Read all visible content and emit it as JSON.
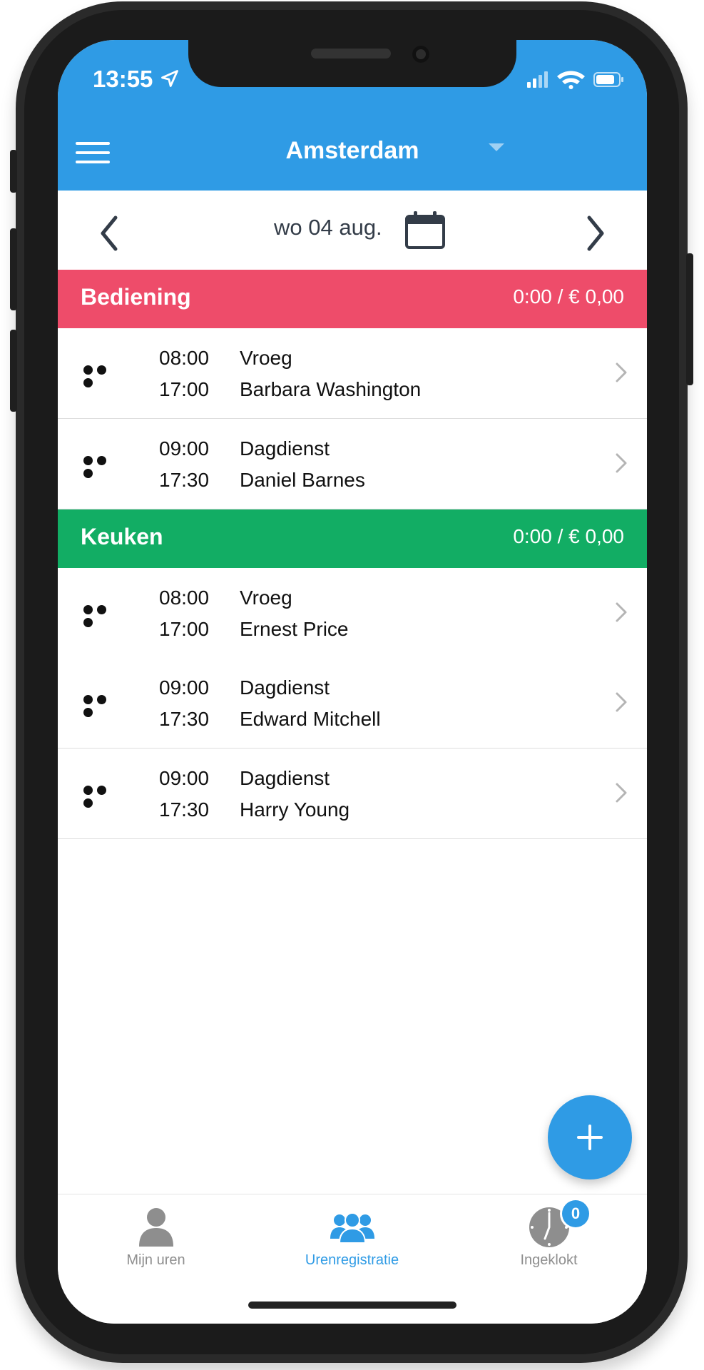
{
  "status": {
    "time": "13:55"
  },
  "header": {
    "title": "Amsterdam"
  },
  "date": {
    "label": "wo 04 aug."
  },
  "sections": [
    {
      "name": "Bediening",
      "total": "0:00 / € 0,00",
      "color": "#ee4c6a",
      "rows": [
        {
          "start": "08:00",
          "end": "17:00",
          "shift": "Vroeg",
          "person": "Barbara Washington"
        },
        {
          "start": "09:00",
          "end": "17:30",
          "shift": "Dagdienst",
          "person": "Daniel Barnes"
        }
      ]
    },
    {
      "name": "Keuken",
      "total": "0:00 / € 0,00",
      "color": "#12ad64",
      "rows": [
        {
          "start": "08:00",
          "end": "17:00",
          "shift": "Vroeg",
          "person": "Ernest Price"
        },
        {
          "start": "09:00",
          "end": "17:30",
          "shift": "Dagdienst",
          "person": "Edward Mitchell"
        },
        {
          "start": "09:00",
          "end": "17:30",
          "shift": "Dagdienst",
          "person": "Harry Young"
        }
      ]
    }
  ],
  "tabs": [
    {
      "label": "Mijn uren",
      "icon": "person-icon",
      "active": false
    },
    {
      "label": "Urenregistratie",
      "icon": "group-icon",
      "active": true
    },
    {
      "label": "Ingeklokt",
      "icon": "clock-icon",
      "active": false,
      "badge": "0"
    }
  ],
  "colors": {
    "accent": "#2f9be5",
    "inactive": "#8e8e8e"
  }
}
